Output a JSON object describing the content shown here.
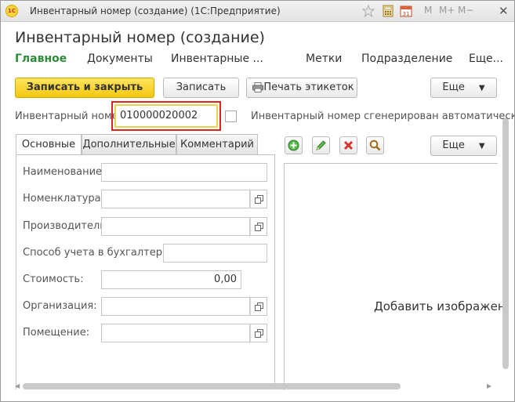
{
  "window": {
    "title": "Инвентарный номер (создание)  (1С:Предприятие)",
    "logo_text": "1С",
    "buttons": {
      "m": "M",
      "m_plus": "M+",
      "m_minus": "M−",
      "close": "✕"
    },
    "icons": [
      "favorite-star-icon",
      "calculator-icon",
      "calendar-icon",
      "close-icon"
    ]
  },
  "form": {
    "title": "Инвентарный номер (создание)",
    "nav": [
      {
        "label": "Главное",
        "active": true
      },
      {
        "label": "Документы"
      },
      {
        "label": "Инвентарные ..."
      },
      {
        "label": "Метки"
      },
      {
        "label": "Подразделение"
      },
      {
        "label": "Еще..."
      }
    ],
    "toolbar": {
      "save_close": "Записать и закрыть",
      "save": "Записать",
      "print_labels": "Печать этикеток",
      "more": "Еще"
    },
    "inv_number": {
      "label": "Инвентарный номер:",
      "value": "010000020002",
      "auto_label": "Инвентарный номер сгенерирован автоматически",
      "auto_checked": false
    },
    "tabs": [
      {
        "label": "Основные",
        "active": true
      },
      {
        "label": "Дополнительные"
      },
      {
        "label": "Комментарий"
      }
    ],
    "fields": {
      "name": {
        "label": "Наименование:",
        "value": ""
      },
      "nomenclature": {
        "label": "Номенклатура:",
        "value": ""
      },
      "manufacturer": {
        "label": "Производитель:",
        "value": ""
      },
      "accounting": {
        "label": "Способ учета в бухгалтерии:",
        "value": ""
      },
      "cost": {
        "label": "Стоимость:",
        "value": "0,00"
      },
      "organization": {
        "label": "Организация:",
        "value": ""
      },
      "room": {
        "label": "Помещение:",
        "value": ""
      }
    },
    "image_panel": {
      "more": "Еще",
      "add_image": "Добавить изображен"
    }
  },
  "colors": {
    "accent_green": "#2e8b3a",
    "primary_button": "#f5c710",
    "highlight_frame": "#dd2222"
  }
}
